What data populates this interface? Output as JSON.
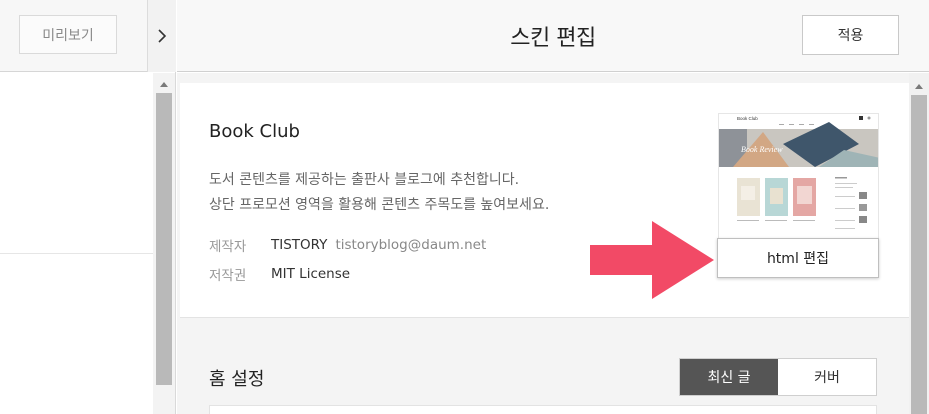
{
  "left_panel": {
    "preview_label": "미리보기",
    "collapse_icon": "chevron-right-icon"
  },
  "header": {
    "title": "스킨 편집",
    "apply_label": "적용"
  },
  "skin": {
    "name": "Book Club",
    "description_line1": "도서 콘텐츠를 제공하는 출판사 블로그에 추천합니다.",
    "description_line2": "상단 프로모션 영역을 활용해 콘텐츠 주목도를 높여보세요.",
    "author_label": "제작자",
    "author_name": "TISTORY",
    "author_email": "tistoryblog@daum.net",
    "copyright_label": "저작권",
    "license": "MIT License",
    "html_edit_label": "html 편집",
    "thumbnail": {
      "site_title": "Book Club",
      "banner_text": "Book Review"
    }
  },
  "home_settings": {
    "title": "홈 설정",
    "options": [
      "최신 글",
      "커버"
    ],
    "selected": "최신 글"
  },
  "colors": {
    "arrow": "#f24a66",
    "toggle_active": "#555555"
  }
}
